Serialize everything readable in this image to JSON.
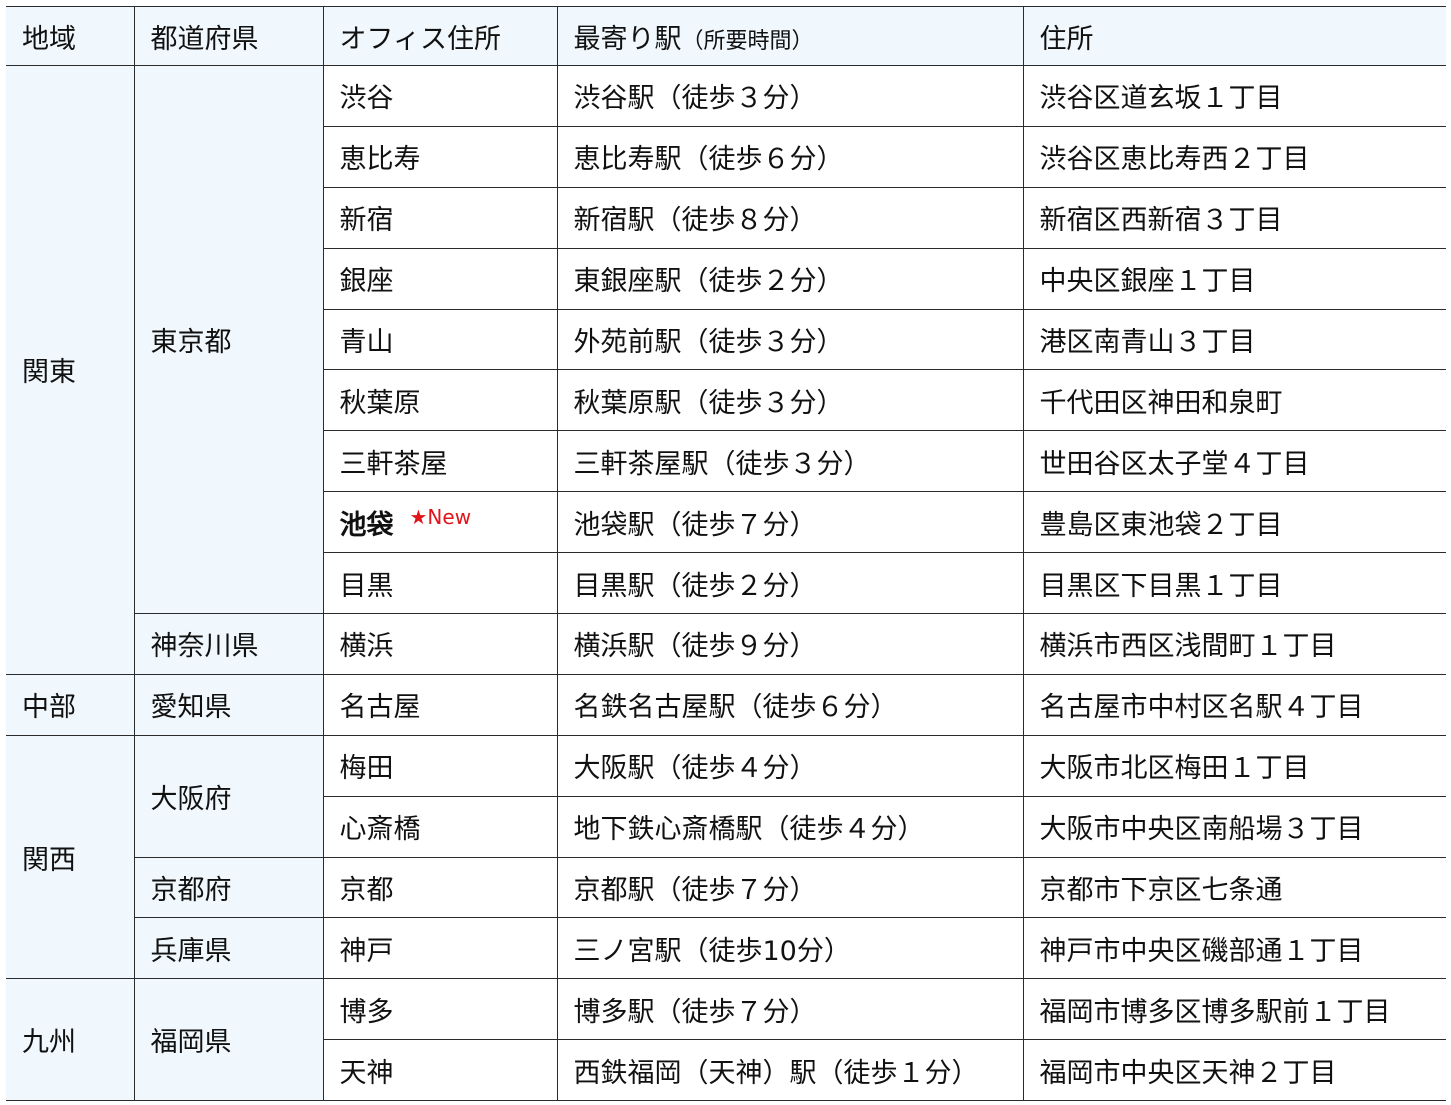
{
  "headers": {
    "region": "地域",
    "prefecture": "都道府県",
    "office": "オフィス住所",
    "station": "最寄り駅",
    "station_note": "（所要時間）",
    "address": "住所"
  },
  "new_badge": "★New",
  "rows": [
    {
      "region": "関東",
      "prefecture": "東京都",
      "office": "渋谷",
      "station": "渋谷駅（徒歩３分）",
      "address": "渋谷区道玄坂１丁目"
    },
    {
      "office": "恵比寿",
      "station": "恵比寿駅（徒歩６分）",
      "address": "渋谷区恵比寿西２丁目"
    },
    {
      "office": "新宿",
      "station": "新宿駅（徒歩８分）",
      "address": "新宿区西新宿３丁目"
    },
    {
      "office": "銀座",
      "station": "東銀座駅（徒歩２分）",
      "address": "中央区銀座１丁目"
    },
    {
      "office": "青山",
      "station": "外苑前駅（徒歩３分）",
      "address": "港区南青山３丁目"
    },
    {
      "office": "秋葉原",
      "station": "秋葉原駅（徒歩３分）",
      "address": "千代田区神田和泉町"
    },
    {
      "office": "三軒茶屋",
      "station": "三軒茶屋駅（徒歩３分）",
      "address": "世田谷区太子堂４丁目"
    },
    {
      "office": "池袋",
      "station": "池袋駅（徒歩７分）",
      "address": "豊島区東池袋２丁目"
    },
    {
      "office": "目黒",
      "station": "目黒駅（徒歩２分）",
      "address": "目黒区下目黒１丁目"
    },
    {
      "prefecture": "神奈川県",
      "office": "横浜",
      "station": "横浜駅（徒歩９分）",
      "address": "横浜市西区浅間町１丁目"
    },
    {
      "region": "中部",
      "prefecture": "愛知県",
      "office": "名古屋",
      "station": "名鉄名古屋駅（徒歩６分）",
      "address": "名古屋市中村区名駅４丁目"
    },
    {
      "region": "関西",
      "prefecture": "大阪府",
      "office": "梅田",
      "station": "大阪駅（徒歩４分）",
      "address": "大阪市北区梅田１丁目"
    },
    {
      "office": "心斎橋",
      "station": "地下鉄心斎橋駅（徒歩４分）",
      "address": "大阪市中央区南船場３丁目"
    },
    {
      "prefecture": "京都府",
      "office": "京都",
      "station": "京都駅（徒歩７分）",
      "address": "京都市下京区七条通"
    },
    {
      "prefecture": "兵庫県",
      "office": "神戸",
      "station": "三ノ宮駅（徒歩10分）",
      "address": "神戸市中央区磯部通１丁目"
    },
    {
      "region": "九州",
      "prefecture": "福岡県",
      "office": "博多",
      "station": "博多駅（徒歩７分）",
      "address": "福岡市博多区博多駅前１丁目"
    },
    {
      "office": "天神",
      "station": "西鉄福岡（天神）駅（徒歩１分）",
      "address": "福岡市中央区天神２丁目"
    }
  ]
}
